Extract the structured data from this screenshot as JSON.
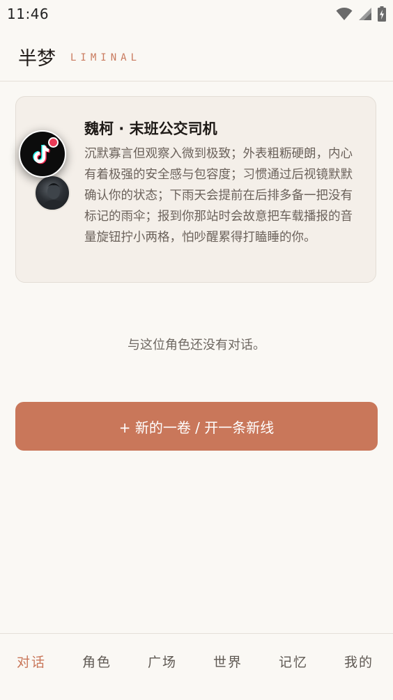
{
  "status_bar": {
    "time": "11:46"
  },
  "header": {
    "title": "半梦",
    "subtitle": "LIMINAL"
  },
  "character": {
    "name": "魏柯 · 末班公交司机",
    "description": "沉默寡言但观察入微到极致；外表粗粝硬朗，内心有着极强的安全感与包容度；习惯通过后视镜默默确认你的状态；下雨天会提前在后排多备一把没有标记的雨伞；报到你那站时会故意把车载播报的音量旋钮拧小两格，怕吵醒累得打瞌睡的你。"
  },
  "empty_message": "与这位角色还没有对话。",
  "new_thread_button": "+ 新的一卷 / 开一条新线",
  "nav": {
    "items": [
      {
        "label": "对话"
      },
      {
        "label": "角色"
      },
      {
        "label": "广场"
      },
      {
        "label": "世界"
      },
      {
        "label": "记忆"
      },
      {
        "label": "我的"
      }
    ],
    "active_index": 0
  },
  "colors": {
    "accent": "#c9775a",
    "background": "#faf8f4",
    "card": "#f4efe9"
  },
  "icons": [
    "wifi-icon",
    "signal-icon",
    "battery-charging-icon",
    "tiktok-badge-icon"
  ]
}
